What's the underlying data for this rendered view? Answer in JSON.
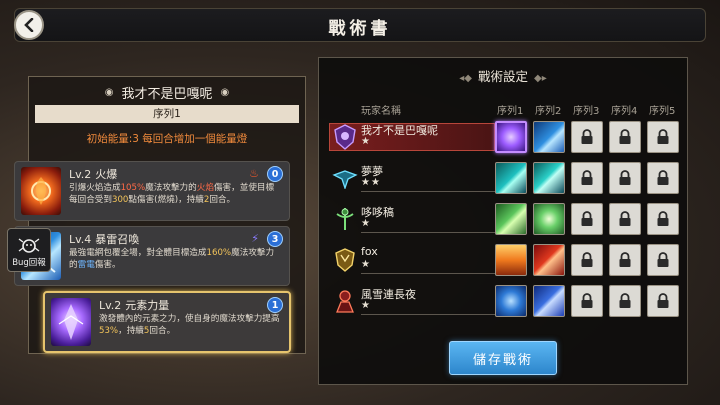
{
  "header": {
    "title": "戰術書"
  },
  "left_panel": {
    "character_name": "我才不是巴嘎呢",
    "sequence_label": "序列1",
    "energy_text": "初始能量:3  每回合增加一個能量燈",
    "skills": [
      {
        "level": "Lv.2",
        "name": "火爆",
        "element_icon": "fire-icon",
        "cost": "0",
        "desc_parts": [
          "引爆火焰造成",
          "105%",
          "魔法攻擊力的",
          "火焰",
          "傷害，並使目標每回合受到",
          "300",
          "點傷害(燃燒)，持續",
          "2",
          "回合。"
        ]
      },
      {
        "level": "Lv.4",
        "name": "暴雷召喚",
        "element_icon": "lightning-icon",
        "cost": "3",
        "desc_parts": [
          "最強電網包覆全場，對全體目標造成",
          "160%",
          "魔法攻擊力的",
          "雷電",
          "傷害。"
        ]
      },
      {
        "level": "Lv.2",
        "name": "元素力量",
        "element_icon": "",
        "cost": "1",
        "desc_parts": [
          "激發體內的元素之力，使自身的魔法攻擊力提高",
          "53%",
          "，持續",
          "5",
          "回合。"
        ]
      }
    ],
    "bug_button": "Bug回報"
  },
  "right_panel": {
    "title": "戰術設定",
    "col_player": "玩家名稱",
    "col_slots": [
      "序列1",
      "序列2",
      "序列3",
      "序列4",
      "序列5"
    ],
    "rows": [
      {
        "name": "我才不是巴嘎呢",
        "stars": "★",
        "emblem": "purple-shield-emblem",
        "slots": [
          "purple-skill",
          "blue-skill",
          "locked",
          "locked",
          "locked"
        ]
      },
      {
        "name": "夢夢",
        "stars": "★★",
        "emblem": "cyan-wings-emblem",
        "slots": [
          "cyan-skill",
          "cyan-skill",
          "locked",
          "locked",
          "locked"
        ]
      },
      {
        "name": "哆哆稿",
        "stars": "★",
        "emblem": "green-staff-emblem",
        "slots": [
          "green-skill",
          "green-skill",
          "locked",
          "locked",
          "locked"
        ]
      },
      {
        "name": "fox",
        "stars": "★",
        "emblem": "gold-shield-emblem",
        "slots": [
          "orange-skill",
          "red-skill",
          "locked",
          "locked",
          "locked"
        ]
      },
      {
        "name": "風雪連長夜",
        "stars": "★",
        "emblem": "red-knight-emblem",
        "slots": [
          "blue-skill",
          "blue-skill",
          "locked",
          "locked",
          "locked"
        ]
      }
    ],
    "save_button": "儲存戰術"
  },
  "colors": {
    "accent_gold": "#e6c46d",
    "energy_orange": "#f08a3c",
    "save_blue": "#3a9be0",
    "active_row_red": "#7a1e1e"
  }
}
